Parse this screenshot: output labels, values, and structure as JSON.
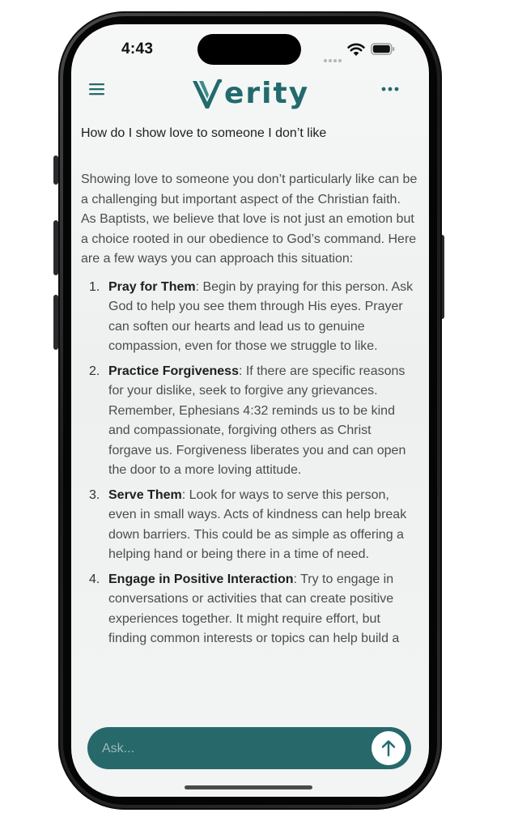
{
  "status_bar": {
    "time": "4:43"
  },
  "header": {
    "logo_text": "erity",
    "logo_text_full": "Verity",
    "brand_color": "#226a6d"
  },
  "question": "How do I show love to someone I don’t like",
  "answer": {
    "intro": "Showing love to someone you don’t particularly like can be a challenging but important aspect of the Christian faith. As Baptists, we believe that love is not just an emotion but a choice rooted in our obedience to God’s command. Here are a few ways you can approach this situation:",
    "items": [
      {
        "number": "1.",
        "title": "Pray for Them",
        "body": ": Begin by praying for this person. Ask God to help you see them through His eyes. Prayer can soften our hearts and lead us to genuine compassion, even for those we struggle to like."
      },
      {
        "number": "2.",
        "title": "Practice Forgiveness",
        "body": ": If there are specific reasons for your dislike, seek to forgive any grievances. Remember, Ephesians 4:32 reminds us to be kind and compassionate, forgiving others as Christ forgave us. Forgiveness liberates you and can open the door to a more loving attitude."
      },
      {
        "number": "3.",
        "title": "Serve Them",
        "body": ": Look for ways to serve this person, even in small ways. Acts of kindness can help break down barriers. This could be as simple as offering a helping hand or being there in a time of need."
      },
      {
        "number": "4.",
        "title": "Engage in Positive Interaction",
        "body": ": Try to engage in conversations or activities that can create positive experiences together. It might require effort, but finding common interests or topics can help build a"
      }
    ]
  },
  "composer": {
    "placeholder": "Ask...",
    "color": "#27686b"
  },
  "icons": {
    "menu": "hamburger-icon",
    "more": "more-horizontal-icon",
    "send": "arrow-up-icon",
    "wifi": "wifi-icon",
    "battery": "battery-icon",
    "signal": "cellular-signal-icon"
  }
}
